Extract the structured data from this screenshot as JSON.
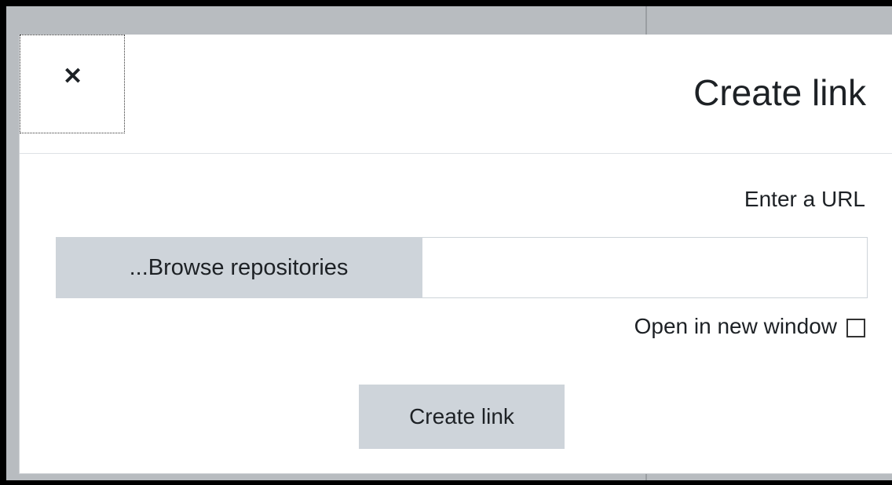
{
  "dialog": {
    "title": "Create link",
    "close_icon": "close-icon"
  },
  "form": {
    "url_label": "Enter a URL",
    "browse_label": "...Browse repositories",
    "url_value": "",
    "url_placeholder": "",
    "new_window_label": "Open in new window",
    "new_window_checked": false,
    "submit_label": "Create link"
  },
  "colors": {
    "backdrop": "#b8bcc0",
    "dialog_bg": "#ffffff",
    "button_bg": "#ced4da",
    "text": "#1d2125"
  }
}
